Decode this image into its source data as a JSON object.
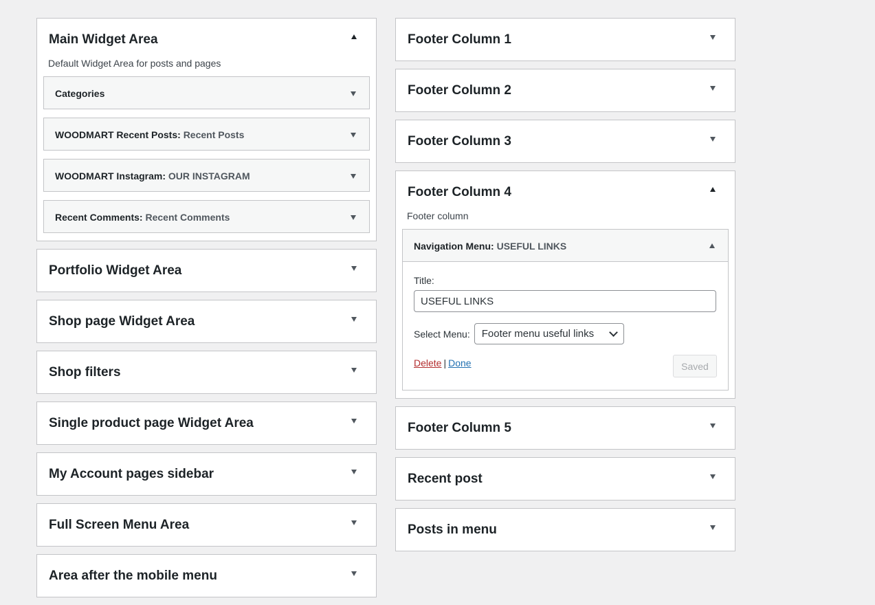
{
  "left_areas": {
    "main": {
      "title": "Main Widget Area",
      "description": "Default Widget Area for posts and pages",
      "widgets": [
        {
          "name": "Categories",
          "sub": ""
        },
        {
          "name": "WOODMART Recent Posts",
          "sub": "Recent Posts"
        },
        {
          "name": "WOODMART Instagram",
          "sub": "OUR INSTAGRAM"
        },
        {
          "name": "Recent Comments",
          "sub": "Recent Comments"
        }
      ]
    },
    "collapsed": [
      "Portfolio Widget Area",
      "Shop page Widget Area",
      "Shop filters",
      "Single product page Widget Area",
      "My Account pages sidebar",
      "Full Screen Menu Area",
      "Area after the mobile menu"
    ]
  },
  "right_areas": {
    "before": [
      "Footer Column 1",
      "Footer Column 2",
      "Footer Column 3"
    ],
    "open": {
      "title": "Footer Column 4",
      "description": "Footer column",
      "widget": {
        "name": "Navigation Menu",
        "sub": "USEFUL LINKS",
        "title_label": "Title:",
        "title_value": "USEFUL LINKS",
        "menu_label": "Select Menu:",
        "menu_value": "Footer menu useful links",
        "delete_label": "Delete",
        "separator": "|",
        "done_label": "Done",
        "saved_label": "Saved"
      }
    },
    "after": [
      "Footer Column 5",
      "Recent post",
      "Posts in menu"
    ]
  },
  "icons": {
    "collapse": "triangle-up-icon",
    "expand": "triangle-down-icon"
  },
  "colors": {
    "background": "#f0f0f1",
    "delete_link": "#b32d2e",
    "done_link": "#2271b1"
  }
}
